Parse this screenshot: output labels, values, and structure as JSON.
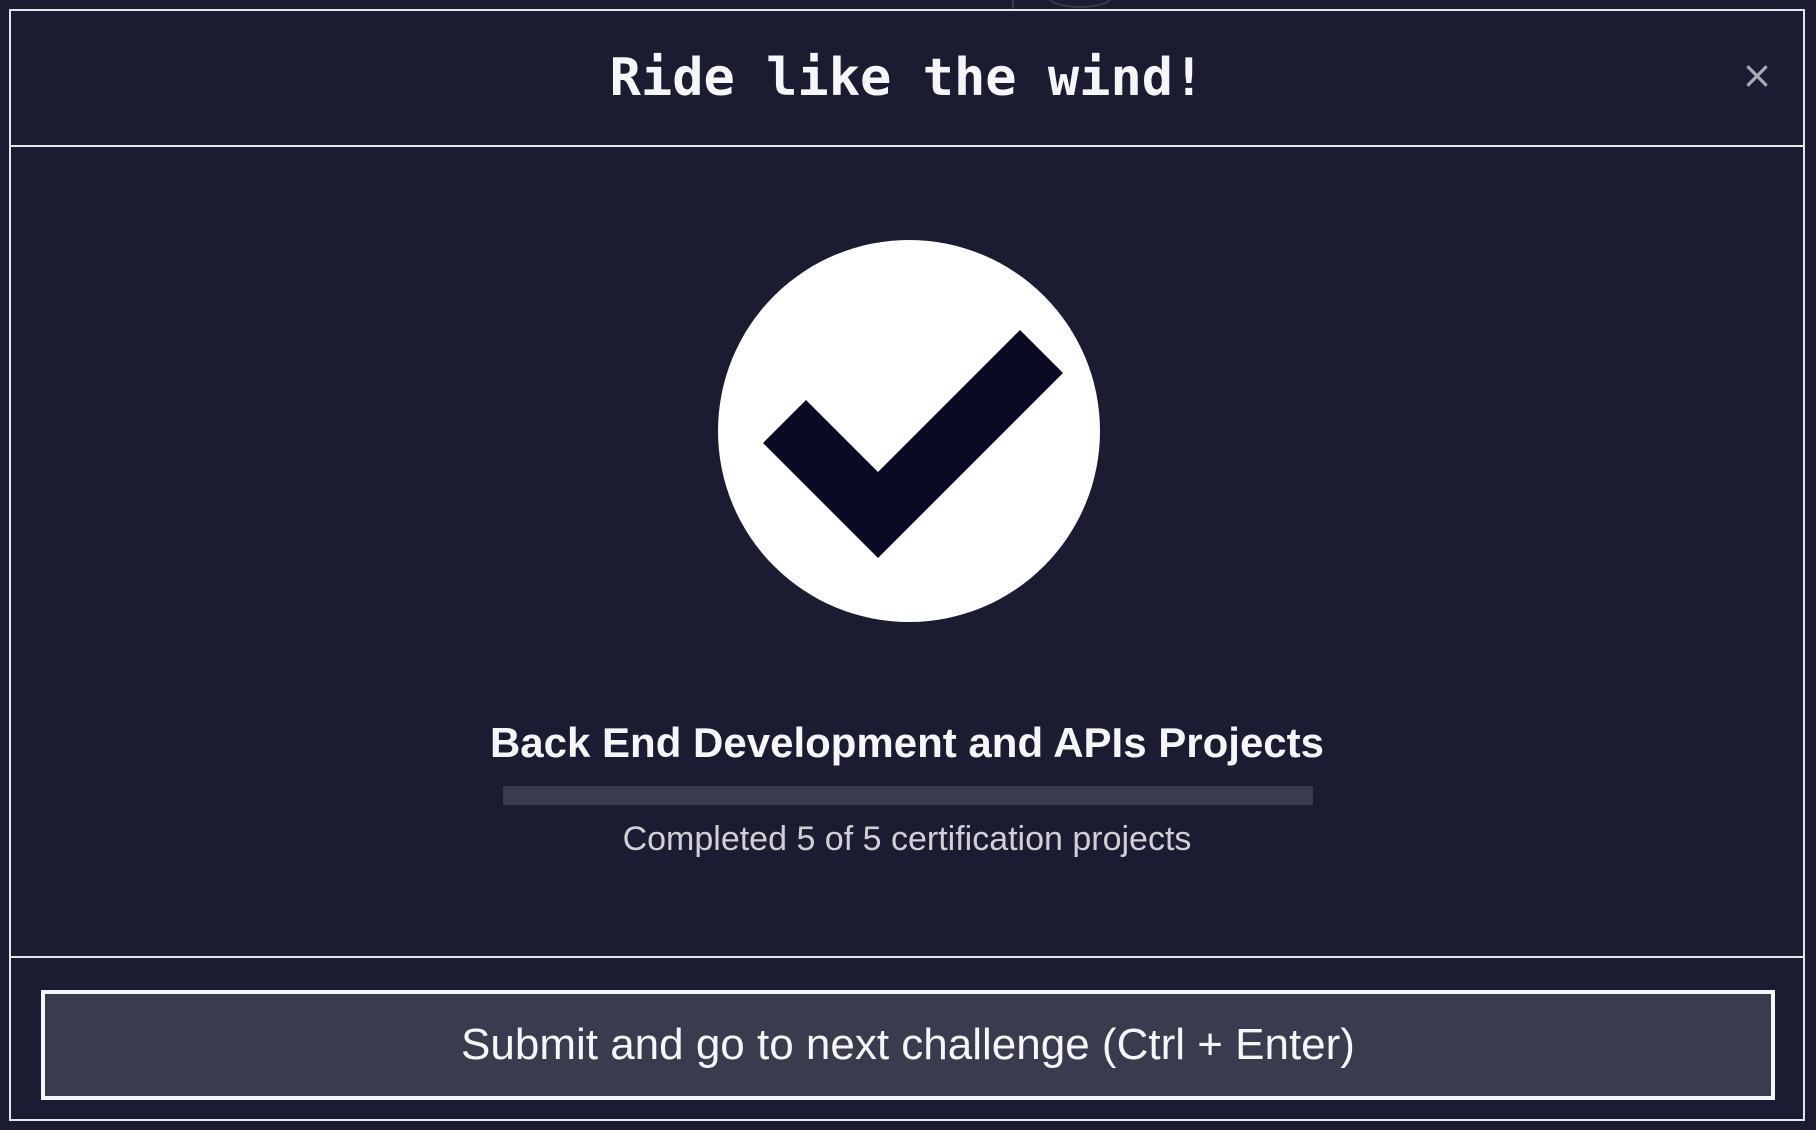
{
  "modal": {
    "title": "Ride like the wind!",
    "close_label": "×"
  },
  "completion": {
    "icon": "check-circle-icon",
    "certification_title": "Back End Development and APIs Projects",
    "progress_completed": 5,
    "progress_total": 5,
    "progress_text": "Completed 5 of 5 certification projects"
  },
  "footer": {
    "submit_label": "Submit and go to next challenge (Ctrl + Enter)"
  },
  "colors": {
    "background": "#1b1b32",
    "border": "#e6e6ea",
    "text": "#f5f6f7",
    "button_bg": "#3b3b4f",
    "checkmark": "#0a0a23"
  }
}
